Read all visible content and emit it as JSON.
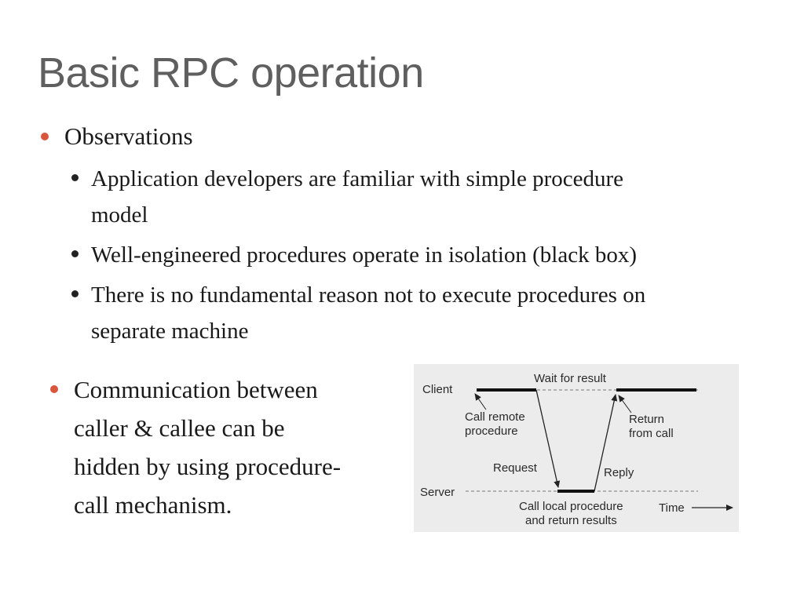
{
  "slide": {
    "title": "Basic RPC operation",
    "bullets": {
      "observations": "Observations",
      "sub1_line1": "Application developers are familiar with simple procedure",
      "sub1_line2": "model",
      "sub2": "Well-engineered procedures operate in isolation (black box)",
      "sub3_line1": "There is no fundamental reason not to execute procedures on",
      "sub3_line2": "separate machine",
      "comm_line1": "Communication between",
      "comm_line2": "caller & callee can be",
      "comm_line3": "hidden by using procedure-",
      "comm_line4": "call mechanism."
    },
    "accent_color": "#d9553b"
  },
  "diagram": {
    "client_label": "Client",
    "server_label": "Server",
    "wait_label": "Wait for result",
    "call_remote_line1": "Call remote",
    "call_remote_line2": "procedure",
    "return_line1": "Return",
    "return_line2": "from call",
    "request_label": "Request",
    "reply_label": "Reply",
    "call_local_line1": "Call local procedure",
    "call_local_line2": "and return results",
    "time_label": "Time"
  }
}
